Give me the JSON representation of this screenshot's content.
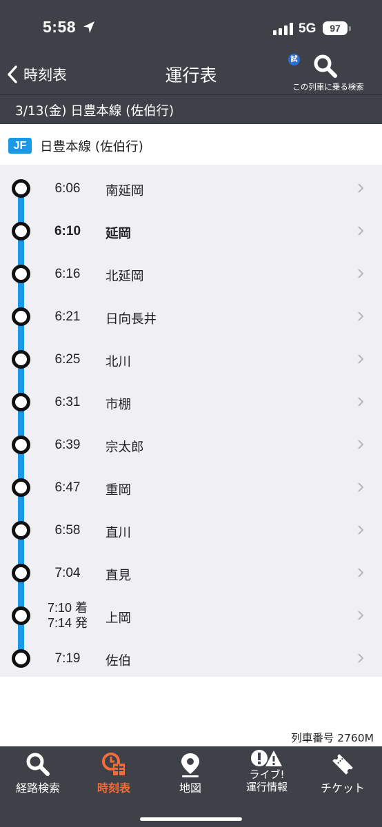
{
  "status_bar": {
    "time": "5:58",
    "network": "5G",
    "battery": "97"
  },
  "nav": {
    "back_label": "時刻表",
    "title": "運行表",
    "test_badge": "試",
    "search_train_label": "この列車に乗る検索"
  },
  "date_bar": {
    "text": "3/13(金) 日豊本線 (佐伯行)"
  },
  "line": {
    "badge": "JF",
    "name": "日豊本線 (佐伯行)",
    "color": "#1a9ae6"
  },
  "stops": [
    {
      "time": "6:06",
      "name": "南延岡"
    },
    {
      "time": "6:10",
      "name": "延岡",
      "bold": true
    },
    {
      "time": "6:16",
      "name": "北延岡"
    },
    {
      "time": "6:21",
      "name": "日向長井"
    },
    {
      "time": "6:25",
      "name": "北川"
    },
    {
      "time": "6:31",
      "name": "市棚"
    },
    {
      "time": "6:39",
      "name": "宗太郎"
    },
    {
      "time": "6:47",
      "name": "重岡"
    },
    {
      "time": "6:58",
      "name": "直川"
    },
    {
      "time": "7:04",
      "name": "直見"
    },
    {
      "time": "7:10 着",
      "time2": "7:14 発",
      "name": "上岡"
    },
    {
      "time": "7:19",
      "name": "佐伯"
    }
  ],
  "train_number": "列車番号 2760M",
  "tabs": [
    {
      "label": "経路検索",
      "icon": "search-icon"
    },
    {
      "label": "時刻表",
      "icon": "timetable-icon",
      "active": true
    },
    {
      "label": "地図",
      "icon": "map-pin-icon"
    },
    {
      "label": "ライブ!",
      "label2": "運行情報",
      "icon": "alert-icon"
    },
    {
      "label": "チケット",
      "icon": "ticket-icon"
    }
  ],
  "colors": {
    "header_bg": "#3f4148",
    "accent": "#f06c3a",
    "line_blue": "#1a9ae6",
    "list_bg": "#efeff4"
  }
}
